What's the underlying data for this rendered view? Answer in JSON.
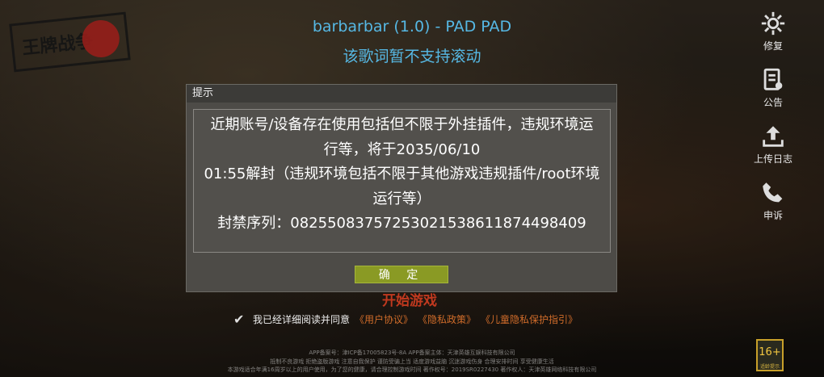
{
  "header": {
    "song_title": "barbarbar (1.0) - PAD PAD",
    "lyrics_notice": "该歌词暂不支持滚动"
  },
  "logo": {
    "text": "王牌战争"
  },
  "sidebar": {
    "items": [
      {
        "label": "修复",
        "icon": "gear-icon"
      },
      {
        "label": "公告",
        "icon": "announcement-icon"
      },
      {
        "label": "上传日志",
        "icon": "upload-icon"
      },
      {
        "label": "申诉",
        "icon": "phone-icon"
      }
    ]
  },
  "dialog": {
    "title": "提示",
    "message_lines": [
      "近期账号/设备存在使用包括但不限于外挂插件，违规环境运",
      "行等，将于2035/06/10",
      "01:55解封（违规环境包括不限于其他游戏违规插件/root环境",
      "运行等）",
      "封禁序列：0825508375725302153861187449840​9"
    ],
    "confirm_label": "确 定"
  },
  "start_button": {
    "label": "开始游戏"
  },
  "agreement": {
    "prefix": "我已经详细阅读并同意",
    "user_agreement": "《用户协议》",
    "privacy_policy": "《隐私政策》",
    "children_policy": "《儿童隐私保护指引》"
  },
  "footer": {
    "line1": "APP备案号：津ICP备17005823号-8A  APP备案主体：天津英雄互娱科技有限公司",
    "line2": "抵制不良游戏 拒绝盗版游戏 注意自我保护 谨防受骗上当 适度游戏益脑 沉迷游戏伤身 合理安排时间 享受健康生活",
    "line3": "本游戏适合年满16周岁以上的用户使用，为了您的健康，请合理控制游戏时间  著作权号：2019SR0227430  著作权人：天津英雄网络科技有限公司"
  },
  "age_rating": {
    "value": "16+",
    "caption": "适龄提示"
  },
  "colors": {
    "title": "#56b8e4",
    "confirm": "#8a9a24",
    "link": "#d06c2a"
  }
}
